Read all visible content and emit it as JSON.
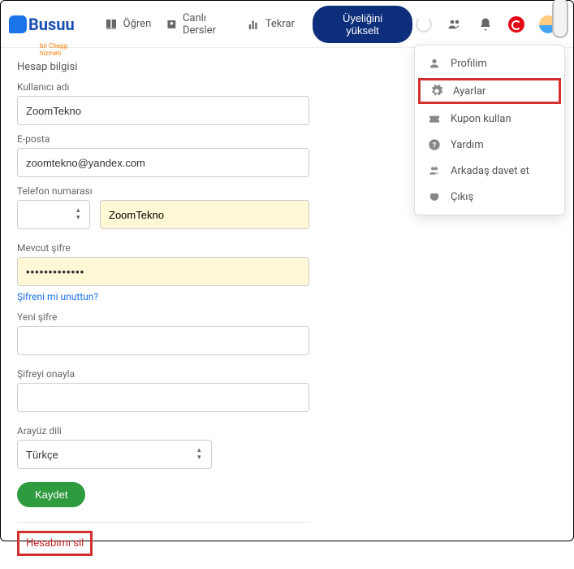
{
  "logo": {
    "text": "Busuu",
    "sub": "bir Chegg hizmeti"
  },
  "nav": {
    "learn": "Öğren",
    "live": "Canlı Dersler",
    "review": "Tekrar"
  },
  "upgrade": "Üyeliğini yükselt",
  "dropdown": {
    "profile": "Profilim",
    "settings": "Ayarlar",
    "coupon": "Kupon kullan",
    "help": "Yardım",
    "invite": "Arkadaş davet et",
    "logout": "Çıkış"
  },
  "form": {
    "section": "Hesap bilgisi",
    "username_label": "Kullanıcı adı",
    "username": "ZoomTekno",
    "email_label": "E-posta",
    "email": "zoomtekno@yandex.com",
    "phone_label": "Telefon numarası",
    "phone_name": "ZoomTekno",
    "current_pw_label": "Mevcut şifre",
    "current_pw": "•••••••••••••",
    "forgot": "Şifreni mi unuttun?",
    "new_pw_label": "Yeni şifre",
    "confirm_pw_label": "Şifreyi onayla",
    "lang_label": "Arayüz dili",
    "lang_value": "Türkçe",
    "save": "Kaydet",
    "delete": "Hesabımı sil"
  }
}
